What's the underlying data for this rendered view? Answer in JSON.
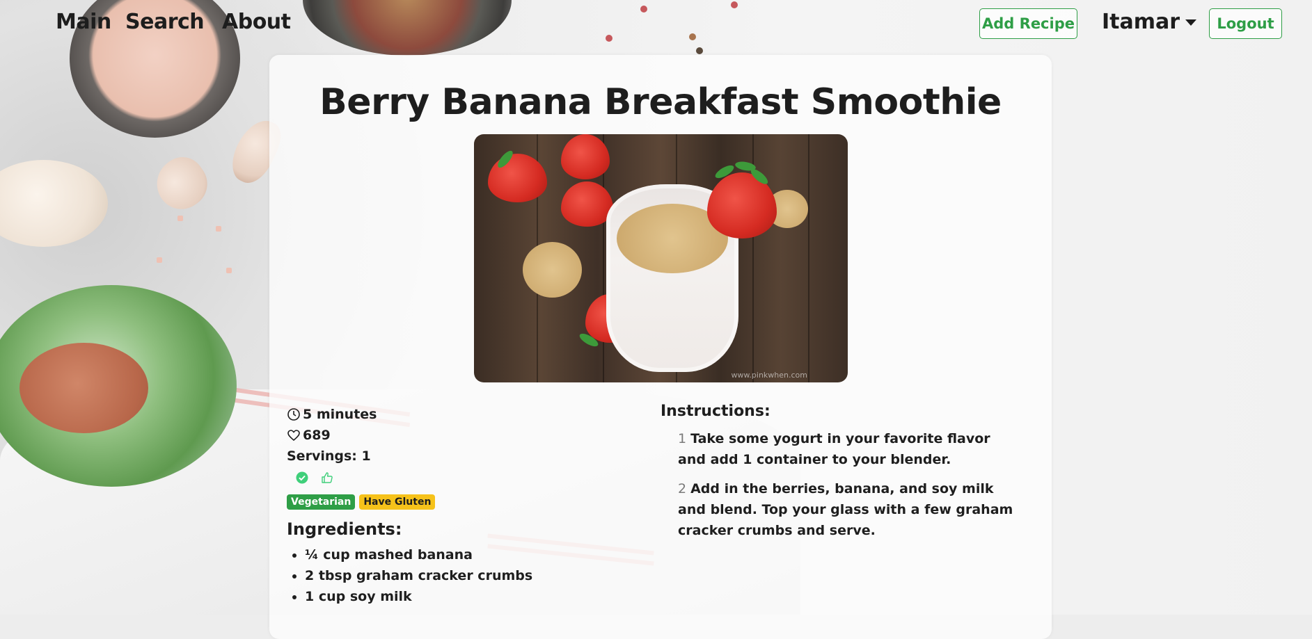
{
  "nav": {
    "links": [
      "Main",
      "Search",
      "About"
    ],
    "add_recipe": "Add Recipe",
    "user_name": "Itamar",
    "logout": "Logout"
  },
  "colors": {
    "accent_green": "#2e9e46",
    "badge_yellow": "#f6c21a"
  },
  "recipe": {
    "title": "Berry Banana Breakfast Smoothie",
    "time": "5 minutes",
    "likes": "689",
    "servings": "Servings: 1",
    "status_icons": [
      "check-circle-icon",
      "thumbs-up-icon"
    ],
    "badges": [
      "Vegetarian",
      "Have Gluten"
    ],
    "image_watermark": "www.pinkwhen.com",
    "ingredients_title": "Ingredients:",
    "ingredients": [
      "¼ cup mashed banana",
      "2 tbsp graham cracker crumbs",
      "1 cup soy milk"
    ],
    "instructions_title": "Instructions:",
    "instructions": [
      {
        "num": "1",
        "text": "Take some yogurt in your favorite flavor and add 1 container to your blender."
      },
      {
        "num": "2",
        "text": "Add in the berries, banana, and soy milk and blend. Top your glass with a few graham cracker crumbs and serve."
      }
    ]
  }
}
